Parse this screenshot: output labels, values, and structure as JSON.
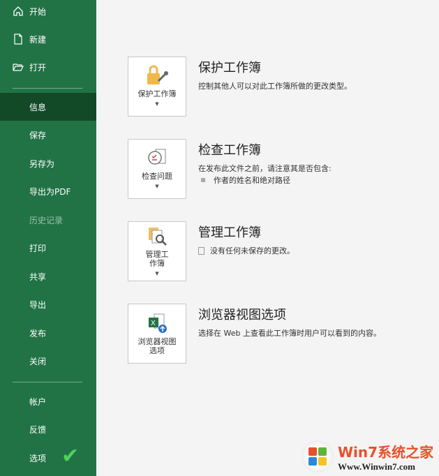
{
  "sidebar": {
    "top": [
      {
        "label": "开始",
        "icon": "home-icon"
      },
      {
        "label": "新建",
        "icon": "new-document-icon"
      },
      {
        "label": "打开",
        "icon": "folder-open-icon"
      }
    ],
    "items": [
      "信息",
      "保存",
      "另存为",
      "导出为PDF",
      "历史记录",
      "打印",
      "共享",
      "导出",
      "发布",
      "关闭"
    ],
    "bottom": [
      "帐户",
      "反馈",
      "选项"
    ],
    "selected": "信息",
    "disabled": "历史记录"
  },
  "sections": [
    {
      "button": "保护工作簿",
      "title": "保护工作簿",
      "desc": "控制其他人可以对此工作簿所做的更改类型。"
    },
    {
      "button": "检查问题",
      "title": "检查工作簿",
      "desc": "在发布此文件之前，请注意其是否包含:",
      "bullet": "作者的姓名和绝对路径"
    },
    {
      "button": "管理工作簿",
      "title": "管理工作簿",
      "desc": "没有任何未保存的更改。"
    },
    {
      "button": "浏览器视图选项",
      "title": "浏览器视图选项",
      "desc": "选择在 Web 上查看此工作簿时用户可以看到的内容。"
    }
  ],
  "watermark": {
    "brand": "Win7系统之家",
    "url": "Www.Winwin7.com"
  },
  "colors": {
    "accent": "#217346",
    "selected": "#124a28"
  }
}
